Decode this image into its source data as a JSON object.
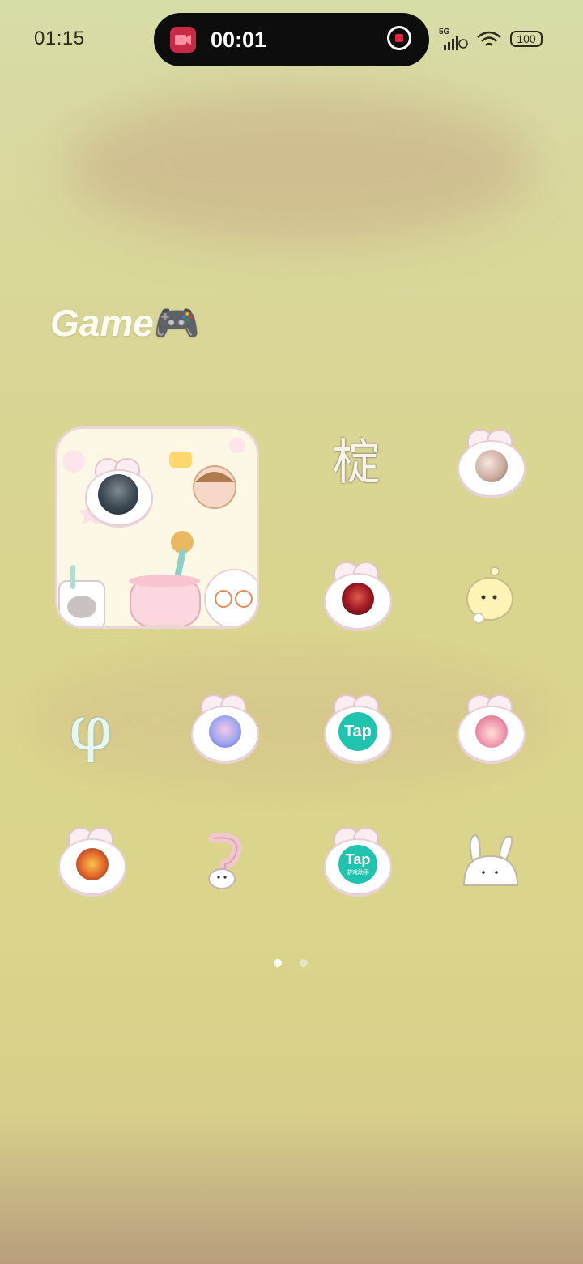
{
  "status_bar": {
    "time": "01:15",
    "recording_time": "00:01",
    "network": "5G",
    "battery": "100"
  },
  "folder": {
    "title": "Game",
    "title_emoji": "🎮"
  },
  "icons": [
    {
      "name": "glyph-app-icon",
      "glyph": "椗"
    },
    {
      "name": "girls-game-icon"
    },
    {
      "name": "red-hero-game-icon"
    },
    {
      "name": "yellow-chick-app-icon"
    },
    {
      "name": "psi-app-icon",
      "glyph": "φ"
    },
    {
      "name": "anime-girl-game-icon"
    },
    {
      "name": "taptap-icon",
      "label": "Tap"
    },
    {
      "name": "pink-hair-game-icon"
    },
    {
      "name": "dragon-game-icon"
    },
    {
      "name": "pink-swirl-app-icon"
    },
    {
      "name": "taptap-helper-icon",
      "label": "Tap",
      "sublabel": "游戏助手"
    },
    {
      "name": "white-bunny-app-icon"
    }
  ],
  "page_indicator": {
    "current": 1,
    "total": 2
  },
  "colors": {
    "pill_bg": "#0d0d0d",
    "record_red": "#e0243c",
    "tap_teal": "#20c4ae",
    "title_white": "#fffdf3"
  }
}
